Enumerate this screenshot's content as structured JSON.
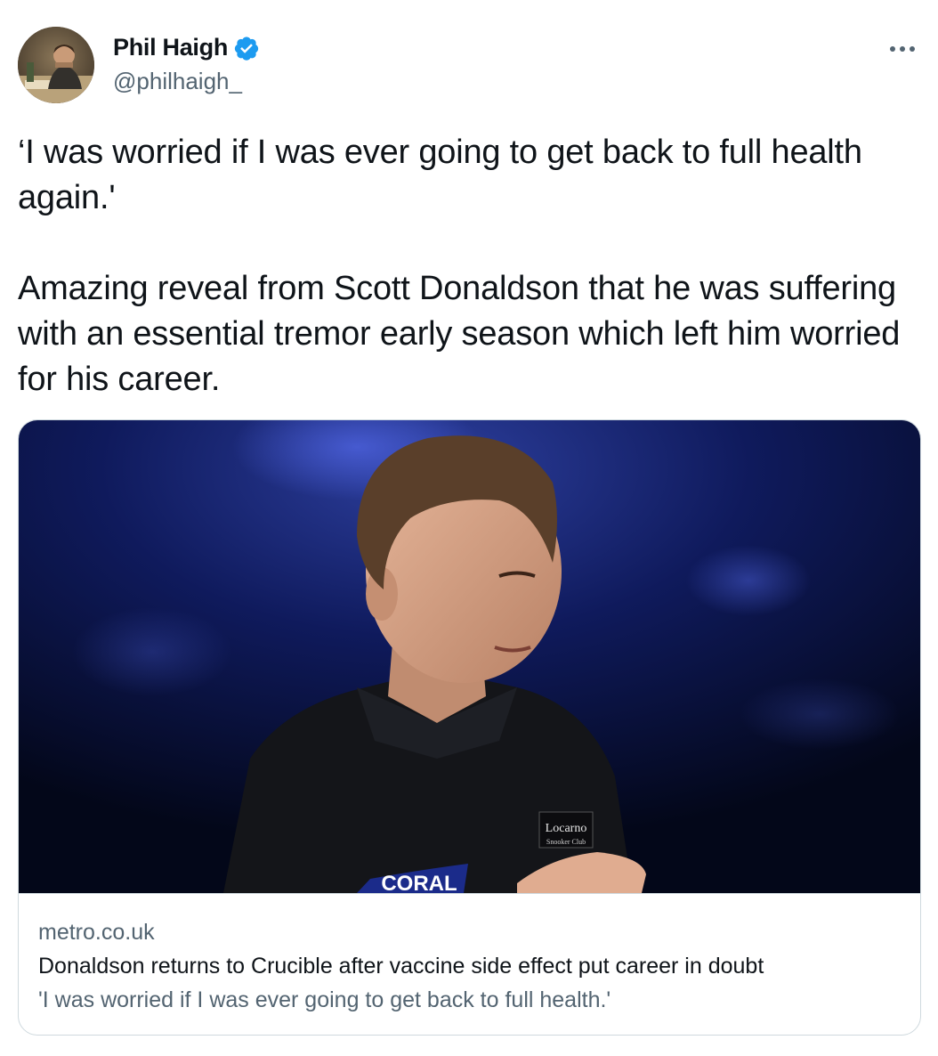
{
  "author": {
    "display_name": "Phil Haigh",
    "handle": "@philhaigh_",
    "verified": true,
    "avatar_icon": "profile-photo",
    "verified_color": "#1d9bf0"
  },
  "tweet": {
    "paragraphs": [
      "‘I was worried if I was ever going to get back to full health again.'",
      "Amazing reveal from Scott Donaldson that he was suffering with an essential tremor early season which left him worried for his career."
    ]
  },
  "card": {
    "domain": "metro.co.uk",
    "title": "Donaldson returns to Crucible after vaccine side effect put career in doubt",
    "description": "'I was worried if I was ever going to get back to full health.'",
    "image": {
      "badge_text": "Locarno",
      "badge_subtext": "Snooker Club",
      "banner_text": "CORAL"
    }
  },
  "icons": {
    "more": "more-horizontal-icon",
    "verified": "verified-badge-icon"
  }
}
